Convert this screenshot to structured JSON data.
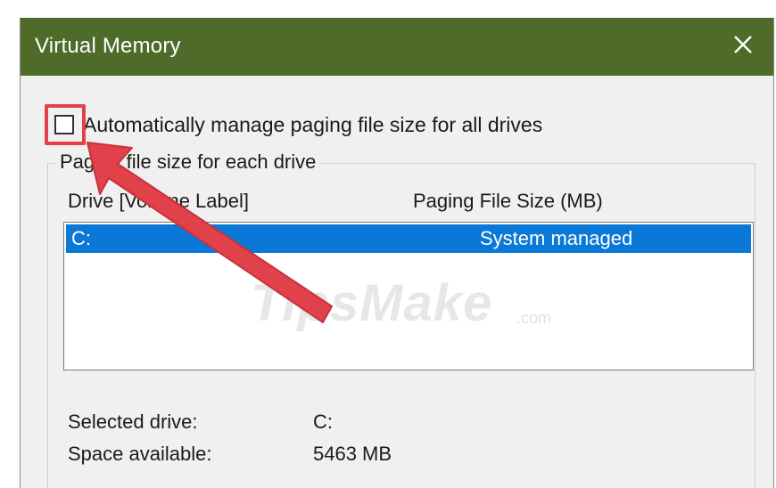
{
  "window": {
    "title": "Virtual Memory",
    "titlebar_color": "#4f6b2a"
  },
  "auto_manage": {
    "label": "Automatically manage paging file size for all drives",
    "checked": false
  },
  "paging_group": {
    "title": "Paging file size for each drive",
    "columns": {
      "drive": "Drive  [Volume Label]",
      "size": "Paging File Size (MB)"
    },
    "rows": [
      {
        "drive": "C:",
        "size": "System managed",
        "selected": true
      }
    ],
    "selection_color": "#0a78d7"
  },
  "selected_info": {
    "selected_drive_label": "Selected drive:",
    "selected_drive_value": "C:",
    "space_available_label": "Space available:",
    "space_available_value": "5463 MB"
  },
  "annotation": {
    "color": "#e0414b"
  },
  "watermark": {
    "text": "TipsMake",
    "suffix": ".com"
  },
  "icons": {
    "close": "close-icon"
  }
}
